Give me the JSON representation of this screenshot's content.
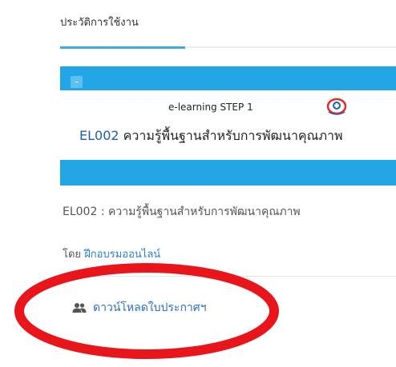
{
  "header": {
    "tab_label": "ประวัติการใช้งาน"
  },
  "card": {
    "collapse_symbol": "-",
    "banner_subtitle": "e-learning STEP 1",
    "banner_code": "EL002",
    "banner_title": " ความรู้พื้นฐานสำหรับการพัฒนาคุณภาพ",
    "accent_color": "#22a6e6"
  },
  "course": {
    "name": "EL002 : ความรู้พื้นฐานสำหรับการพัฒนาคุณภาพ",
    "by_label": "โดย ",
    "author": "ฝึกอบรมออนไลน์"
  },
  "actions": {
    "download_label": "ดาวน์โหลดใบประกาศฯ",
    "download_icon": "users-icon"
  },
  "annotation": {
    "color": "#e8161b"
  }
}
